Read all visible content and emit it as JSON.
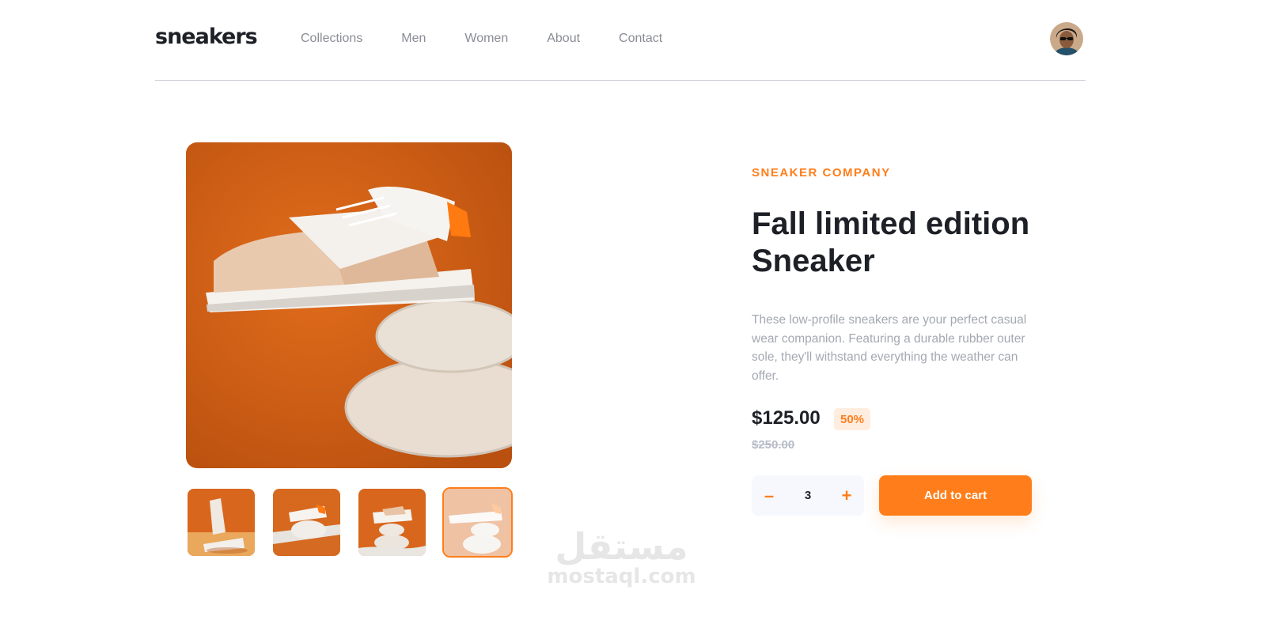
{
  "header": {
    "logo": "sneakers",
    "nav": [
      "Collections",
      "Men",
      "Women",
      "About",
      "Contact"
    ]
  },
  "product": {
    "company": "SNEAKER COMPANY",
    "title_line1": "Fall limited edition",
    "title_line2": "Sneaker",
    "description": "These low-profile sneakers are your perfect casual wear companion. Featuring a durable rubber outer sole, they'll withstand everything the weather can offer.",
    "price": "$125.00",
    "discount": "50%",
    "old_price": "$250.00",
    "quantity": "3",
    "minus": "–",
    "plus": "+",
    "add_to_cart": "Add to cart"
  },
  "gallery": {
    "thumbnail_count": 4,
    "active_thumbnail": 4
  },
  "watermark": {
    "arabic": "مستقل",
    "latin": "mostaql.com"
  },
  "colors": {
    "accent": "#ff7e1b",
    "accent_pale": "#ffede0",
    "dark": "#1d2026",
    "muted": "#a4a8b2",
    "product_bg": "#c95a12"
  }
}
